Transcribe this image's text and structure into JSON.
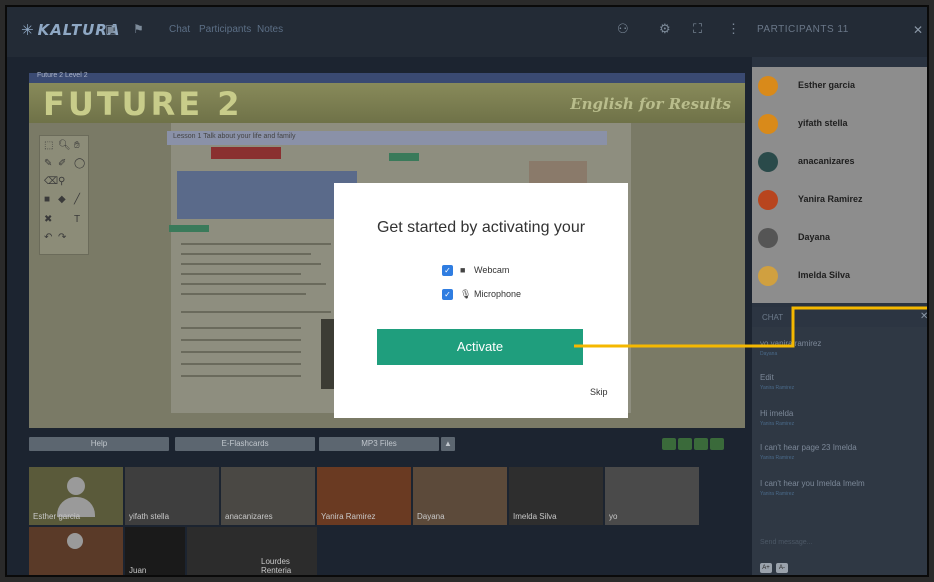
{
  "app": {
    "logo": "KALTURA",
    "tabs": [
      "Chat",
      "Participants",
      "Notes"
    ]
  },
  "participants_panel": {
    "header": "PARTICIPANTS 11",
    "people": [
      {
        "name": "Esther garcia",
        "color": "#d98a1a"
      },
      {
        "name": "yifath stella",
        "color": "#d98a1a"
      },
      {
        "name": "anacanizares",
        "color": "#2a4a4a"
      },
      {
        "name": "Yanira Ramirez",
        "color": "#b8451e"
      },
      {
        "name": "Dayana",
        "color": "#555555"
      },
      {
        "name": "Imelda Silva",
        "color": "#d0a040"
      }
    ]
  },
  "chat_panel": {
    "header": "CHAT",
    "messages": [
      {
        "text": "yo yanira ramirez",
        "sub": "Dayana"
      },
      {
        "text": "Edit",
        "sub": "Yanira Ramirez"
      },
      {
        "text": "Hi imelda",
        "sub": "Yanira Ramirez"
      },
      {
        "text": "I can't hear page 23 Imelda",
        "sub": "Yanira Ramirez"
      },
      {
        "text": "I can't hear you Imelda Imelm",
        "sub": "Yanira Ramirez"
      }
    ],
    "input_placeholder": "Send message...",
    "buttons": [
      "A+",
      "A-"
    ]
  },
  "presentation": {
    "window_title": "Future 2 Level 2",
    "book_title": "FUTURE 2",
    "subtitle": "English for Results",
    "lesson_header": "Lesson 1  Talk about your life and family",
    "bottom_buttons": [
      "Help",
      "E-Flashcards",
      "MP3 Files"
    ]
  },
  "videos": [
    {
      "name": "Esther garcia"
    },
    {
      "name": "yifath stella"
    },
    {
      "name": "anacanizares"
    },
    {
      "name": "Yanira Ramirez"
    },
    {
      "name": "Dayana"
    },
    {
      "name": "Imelda Silva"
    },
    {
      "name": "yo"
    },
    {
      "name": "Juan"
    },
    {
      "name": "Lourdes Renteria"
    }
  ],
  "modal": {
    "title": "Get started by activating your",
    "options": [
      {
        "label": "Webcam",
        "checked": true
      },
      {
        "label": "Microphone",
        "checked": true
      }
    ],
    "primary_button": "Activate",
    "secondary_button": "Skip"
  },
  "colors": {
    "accent_green": "#1f9e7d",
    "checkbox_blue": "#2f7de1",
    "annotation_yellow": "#f5b800"
  }
}
